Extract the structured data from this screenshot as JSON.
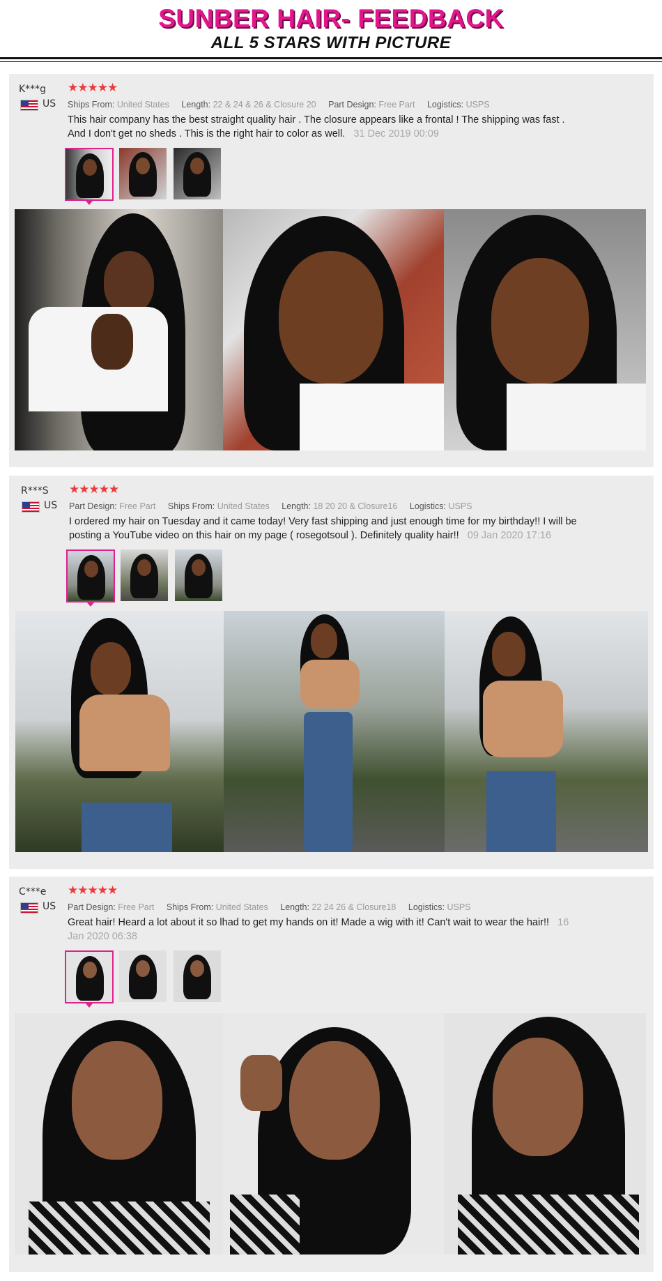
{
  "header": {
    "title": "SUNBER HAIR- FEEDBACK",
    "subtitle": "ALL 5 STARS WITH PICTURE"
  },
  "colors": {
    "accent_pink": "#e3158d",
    "star_red": "#ec3b3b",
    "card_bg": "#ececec"
  },
  "reviews": [
    {
      "user": "K***g",
      "country": "US",
      "stars": "★★★★★",
      "meta": [
        {
          "label": "Ships From:",
          "value": "United States"
        },
        {
          "label": "Length:",
          "value": "22 & 24 & 26 & Closure 20"
        },
        {
          "label": "Part Design:",
          "value": "Free Part"
        },
        {
          "label": "Logistics:",
          "value": "USPS"
        }
      ],
      "text": "This hair company has the best straight quality hair . The closure appears like a frontal ! The shipping was fast . And I don't get no sheds . This is the right hair to color as well.",
      "date": "31 Dec 2019 00:09",
      "thumb_icons": [
        "portrait-photo-icon",
        "portrait-photo-icon",
        "portrait-photo-icon"
      ],
      "photo_icons": [
        "portrait-photo-icon",
        "portrait-photo-icon",
        "portrait-photo-icon"
      ]
    },
    {
      "user": "R***S",
      "country": "US",
      "stars": "★★★★★",
      "meta": [
        {
          "label": "Part Design:",
          "value": "Free Part"
        },
        {
          "label": "Ships From:",
          "value": "United States"
        },
        {
          "label": "Length:",
          "value": "18 20 20 & Closure16"
        },
        {
          "label": "Logistics:",
          "value": "USPS"
        }
      ],
      "text": "I ordered my hair on Tuesday and it came today! Very fast shipping and just enough time for my birthday!! I will be posting a YouTube video on this hair on my page ( rosegotsoul ). Definitely quality hair!!",
      "date": "09 Jan 2020 17:16",
      "thumb_icons": [
        "portrait-photo-icon",
        "portrait-photo-icon",
        "portrait-photo-icon"
      ],
      "photo_icons": [
        "portrait-photo-icon",
        "portrait-photo-icon",
        "portrait-photo-icon"
      ]
    },
    {
      "user": "C***e",
      "country": "US",
      "stars": "★★★★★",
      "meta": [
        {
          "label": "Part Design:",
          "value": "Free Part"
        },
        {
          "label": "Ships From:",
          "value": "United States"
        },
        {
          "label": "Length:",
          "value": "22 24 26 & Closure18"
        },
        {
          "label": "Logistics:",
          "value": "USPS"
        }
      ],
      "text": "Great hair! Heard a lot about it so lhad to get my hands on it! Made a wig with it! Can't wait to wear the hair!!",
      "date": "16 Jan 2020 06:38",
      "thumb_icons": [
        "portrait-photo-icon",
        "portrait-photo-icon",
        "portrait-photo-icon"
      ],
      "photo_icons": [
        "portrait-photo-icon",
        "portrait-photo-icon",
        "portrait-photo-icon"
      ]
    }
  ]
}
